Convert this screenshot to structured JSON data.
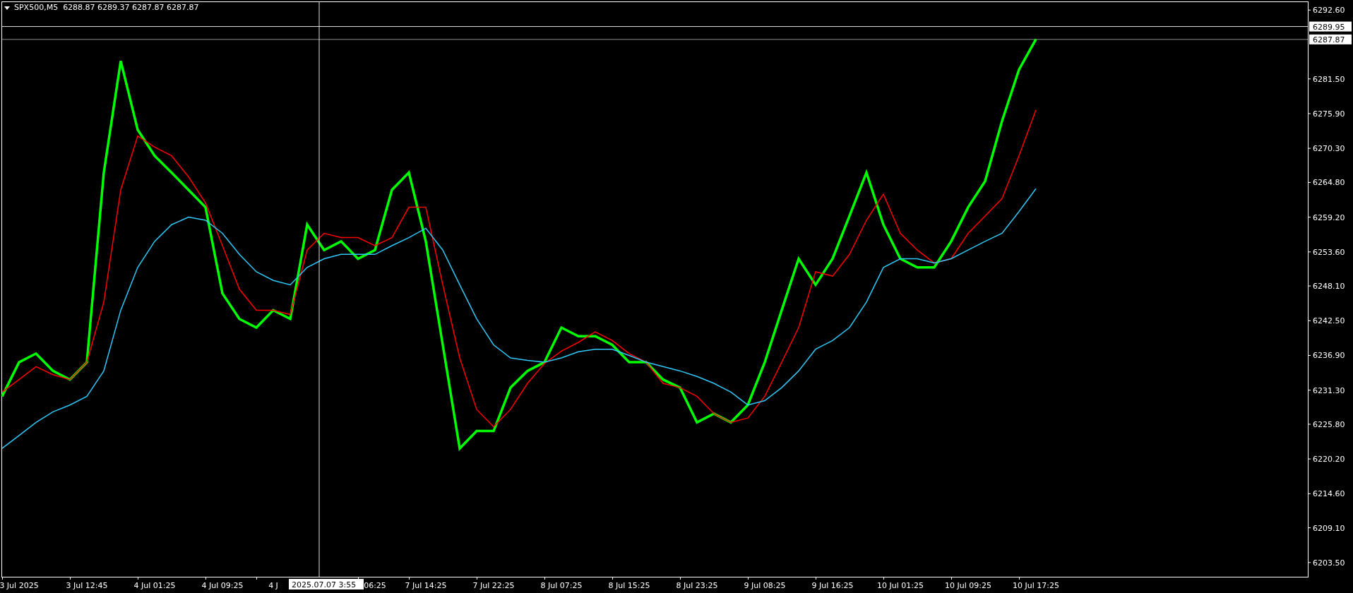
{
  "chart": {
    "title": "SPX500,M5  6288.87 6289.37 6287.87 6287.87",
    "chart_data": {
      "type": "line",
      "categories": [
        null,
        "3 Jul 2025",
        null,
        null,
        null,
        "3 Jul 12:45",
        null,
        null,
        null,
        "4 Jul 01:25",
        null,
        null,
        null,
        "4 Jul 09:25",
        null,
        null,
        "4 J",
        null,
        null,
        null,
        null,
        null,
        "06:25",
        null,
        null,
        "7 Jul 14:25",
        null,
        null,
        null,
        "7 Jul 22:25",
        null,
        null,
        null,
        "8 Jul 07:25",
        null,
        null,
        null,
        "8 Jul 15:25",
        null,
        null,
        null,
        "8 Jul 23:25",
        null,
        null,
        null,
        "9 Jul 08:25",
        null,
        null,
        null,
        "9 Jul 16:25",
        null,
        null,
        null,
        "10 Jul 01:25",
        null,
        null,
        null,
        "10 Jul 09:25",
        null,
        null,
        null,
        "10 Jul 17:25"
      ],
      "series": [
        {
          "color": "#00ff00",
          "values": [
            6230.3,
            6235.8,
            6237.2,
            6234.4,
            6233.0,
            6235.8,
            6266.4,
            6284.4,
            6273.3,
            6269.1,
            6266.4,
            6263.6,
            6260.8,
            6246.9,
            6242.8,
            6241.4,
            6244.2,
            6242.8,
            6258.0,
            6253.9,
            6255.3,
            6252.5,
            6253.9,
            6263.6,
            6266.4,
            6255.3,
            6238.6,
            6221.9,
            6224.7,
            6224.7,
            6231.7,
            6234.4,
            6235.8,
            6241.4,
            6240.0,
            6240.0,
            6238.6,
            6235.8,
            6235.8,
            6233.0,
            6231.7,
            6226.1,
            6227.5,
            6226.1,
            6228.9,
            6235.8,
            6244.2,
            6252.5,
            6248.3,
            6252.5,
            6259.4,
            6266.4,
            6258.0,
            6252.5,
            6251.1,
            6251.1,
            6255.3,
            6260.8,
            6265.0,
            6274.7,
            6283.0,
            6287.9
          ]
        },
        {
          "color": "#ff0000",
          "values": [
            6231.0,
            6233.0,
            6235.1,
            6233.8,
            6233.0,
            6235.8,
            6245.5,
            6263.6,
            6272.3,
            6270.5,
            6269.1,
            6265.7,
            6261.5,
            6254.6,
            6247.6,
            6244.2,
            6244.2,
            6243.5,
            6253.9,
            6256.6,
            6255.9,
            6255.9,
            6254.6,
            6255.9,
            6260.8,
            6260.8,
            6248.3,
            6236.5,
            6228.2,
            6225.4,
            6228.2,
            6232.4,
            6235.6,
            6237.6,
            6239.0,
            6240.7,
            6239.3,
            6237.2,
            6235.8,
            6232.4,
            6231.7,
            6230.3,
            6227.5,
            6226.1,
            6226.8,
            6230.3,
            6235.8,
            6241.4,
            6250.4,
            6249.7,
            6253.2,
            6258.7,
            6262.9,
            6256.6,
            6253.9,
            6251.8,
            6252.5,
            6256.6,
            6259.4,
            6262.2,
            6269.1,
            6276.5
          ]
        },
        {
          "color": "#30c8f8",
          "values": [
            6221.9,
            6224.0,
            6226.1,
            6227.8,
            6228.9,
            6230.3,
            6234.4,
            6244.2,
            6251.1,
            6255.3,
            6258.0,
            6259.2,
            6258.7,
            6256.6,
            6253.2,
            6250.4,
            6249.0,
            6248.3,
            6251.1,
            6252.5,
            6253.2,
            6253.2,
            6253.2,
            6254.6,
            6255.9,
            6257.4,
            6253.9,
            6248.3,
            6242.8,
            6238.6,
            6236.5,
            6236.1,
            6235.8,
            6236.5,
            6237.5,
            6237.9,
            6237.9,
            6236.9,
            6235.8,
            6235.1,
            6234.4,
            6233.5,
            6232.4,
            6231.0,
            6228.9,
            6229.6,
            6231.7,
            6234.4,
            6237.9,
            6239.3,
            6241.4,
            6245.5,
            6251.1,
            6252.5,
            6252.5,
            6251.8,
            6252.5,
            6253.9,
            6255.3,
            6256.6,
            6260.1,
            6263.8
          ]
        }
      ],
      "ylim": [
        6201.2,
        6294.0
      ],
      "yticks": [
        {
          "value": 6292.6,
          "label": "6292.60"
        },
        {
          "value": 6281.5,
          "label": "6281.50"
        },
        {
          "value": 6275.9,
          "label": "6275.90"
        },
        {
          "value": 6270.3,
          "label": "6270.30"
        },
        {
          "value": 6264.8,
          "label": "6264.80"
        },
        {
          "value": 6259.2,
          "label": "6259.20"
        },
        {
          "value": 6253.6,
          "label": "6253.60"
        },
        {
          "value": 6248.1,
          "label": "6248.10"
        },
        {
          "value": 6242.5,
          "label": "6242.50"
        },
        {
          "value": 6236.9,
          "label": "6236.90"
        },
        {
          "value": 6231.3,
          "label": "6231.30"
        },
        {
          "value": 6225.8,
          "label": "6225.80"
        },
        {
          "value": 6220.2,
          "label": "6220.20"
        },
        {
          "value": 6214.6,
          "label": "6214.60"
        },
        {
          "value": 6209.1,
          "label": "6209.10"
        },
        {
          "value": 6203.5,
          "label": "6203.50"
        }
      ],
      "annotations": [
        "2025.07.07 3:55",
        "6289.95",
        "6287.87"
      ],
      "ref_lines": [
        {
          "axis": "y",
          "value": 6287.87,
          "color": "#8c8c8c"
        }
      ]
    }
  }
}
